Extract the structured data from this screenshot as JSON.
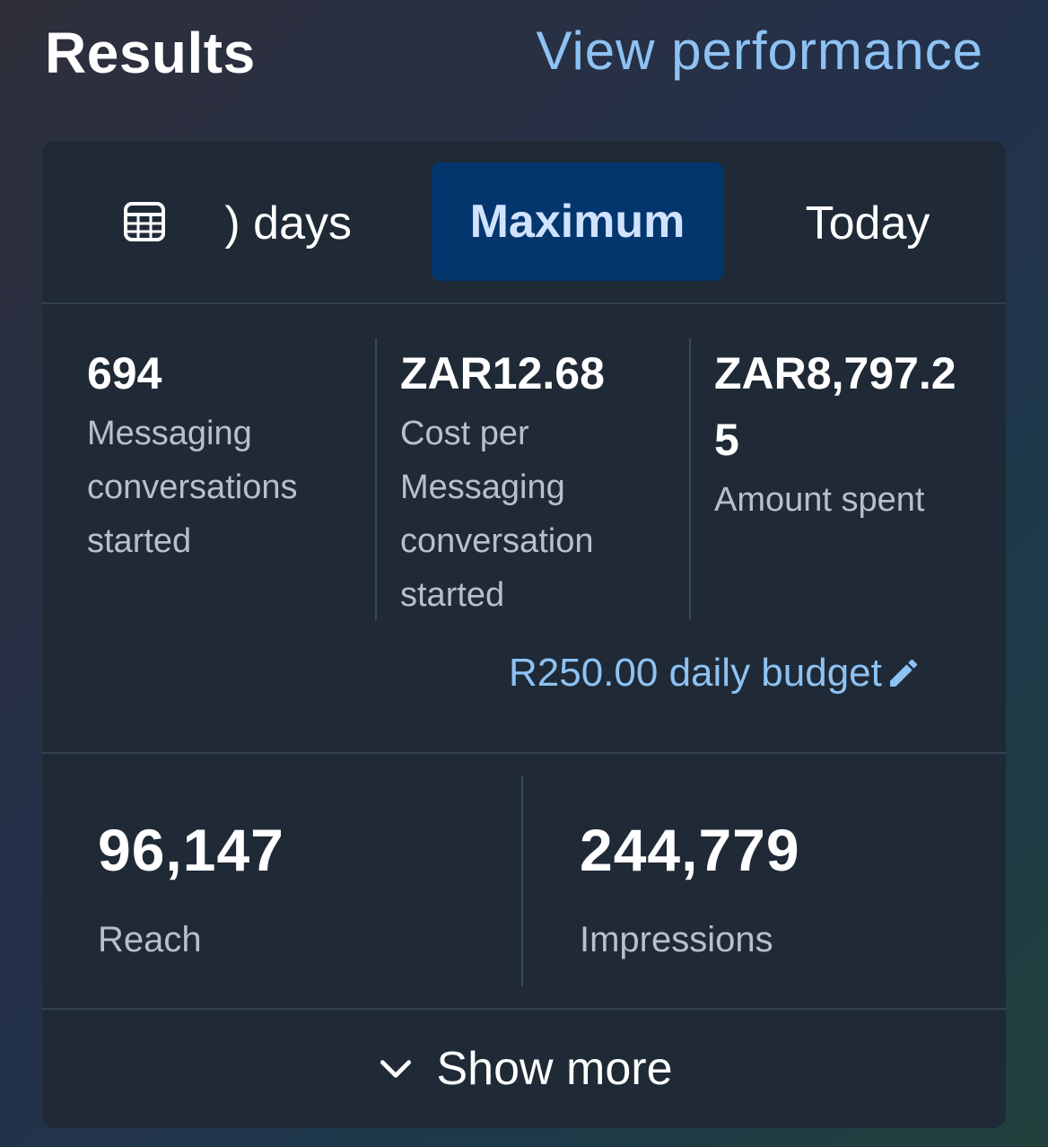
{
  "header": {
    "title": "Results",
    "view_performance_label": "View performance"
  },
  "tabs": {
    "calendar_icon": "calendar-icon",
    "days_label": ") days",
    "maximum_label": "Maximum",
    "today_label": "Today",
    "active": "Maximum"
  },
  "metrics": {
    "conversations": {
      "value": "694",
      "label_lines": [
        "Messaging",
        "conversations",
        "started"
      ]
    },
    "cost_per": {
      "value": "ZAR12.68",
      "label_lines": [
        "Cost per",
        "Messaging",
        "conversation",
        "started"
      ]
    },
    "amount_spent": {
      "value_lines": [
        "ZAR8,797.2",
        "5"
      ],
      "label": "Amount spent"
    }
  },
  "budget": {
    "label": "R250.00 daily budget",
    "edit_icon": "pencil-icon"
  },
  "summary": {
    "reach_value": "96,147",
    "reach_label": "Reach",
    "impressions_value": "244,779",
    "impressions_label": "Impressions"
  },
  "footer": {
    "show_more_label": "Show more",
    "chevron_icon": "chevron-down-icon"
  },
  "colors": {
    "accent_link": "#8ec2f3",
    "active_tab": "#04366e",
    "card_bg": "#1f2a36"
  }
}
